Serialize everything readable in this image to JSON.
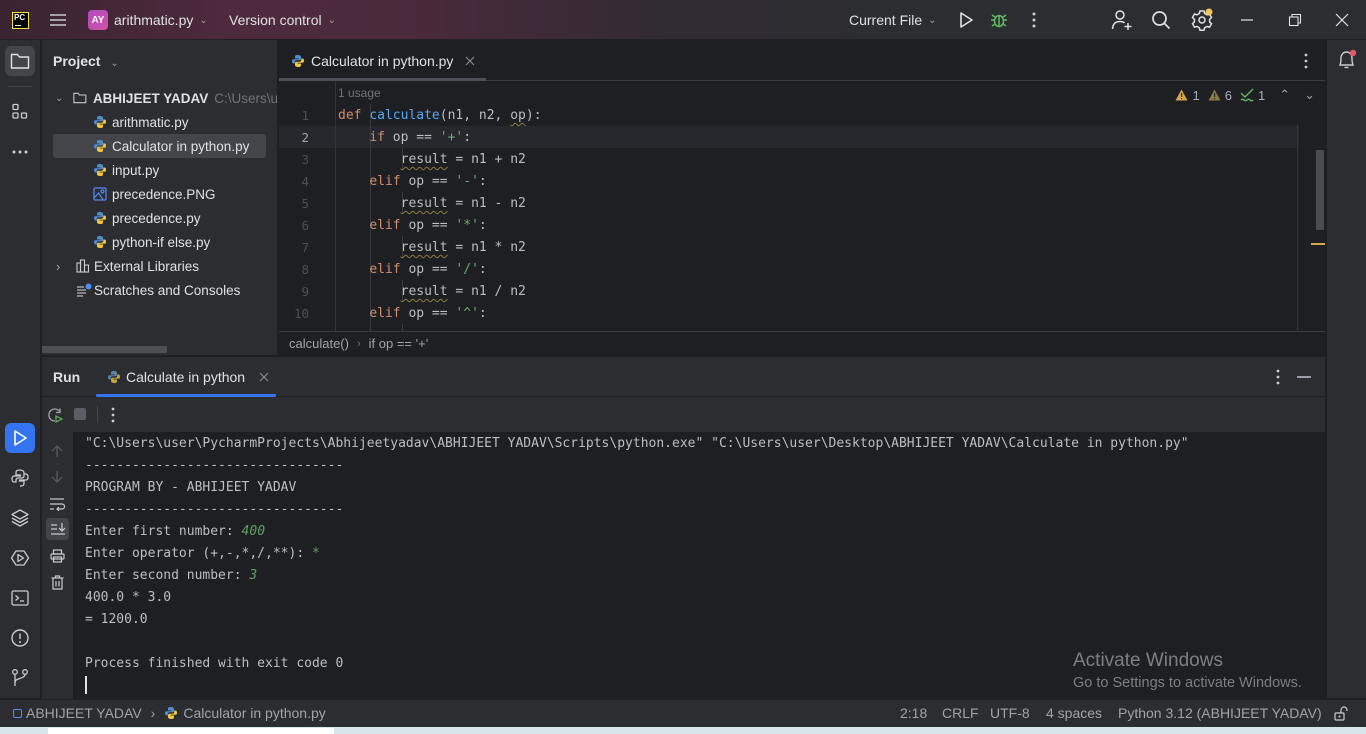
{
  "titlebar": {
    "logo": "PC",
    "project_badge": "AY",
    "project_name": "arithmatic.py",
    "vcs_label": "Version control",
    "run_config": "Current File",
    "icons": [
      "menu-icon",
      "run-icon",
      "debug-icon",
      "more-icon",
      "add-user-icon",
      "search-icon",
      "settings-icon",
      "minimize-icon",
      "restore-icon",
      "close-icon"
    ]
  },
  "project_panel": {
    "title": "Project",
    "root": {
      "name": "ABHIJEET YADAV",
      "path": "C:\\Users\\u"
    },
    "files": [
      {
        "name": "arithmatic.py",
        "icon": "python-file-icon"
      },
      {
        "name": "Calculator in python.py",
        "icon": "python-file-icon",
        "selected": true
      },
      {
        "name": "input.py",
        "icon": "python-file-icon"
      },
      {
        "name": "precedence.PNG",
        "icon": "image-file-icon"
      },
      {
        "name": "precedence.py",
        "icon": "python-file-icon"
      },
      {
        "name": "python-if else.py",
        "icon": "python-file-icon"
      }
    ],
    "external_libraries": "External Libraries",
    "scratches": "Scratches and Consoles"
  },
  "editor": {
    "tab_label": "Calculator in python.py",
    "usage_hint": "1 usage",
    "inspections": {
      "errors": "1",
      "warnings": "6",
      "typos": "1"
    },
    "line_numbers": [
      "1",
      "2",
      "3",
      "4",
      "5",
      "6",
      "7",
      "8",
      "9",
      "10"
    ],
    "current_line": "2",
    "code": [
      {
        "kw": "def",
        "fn": "calculate",
        "rest_a": "(n1, n2, ",
        "wavy": "op",
        "rest_b": "):"
      },
      {
        "indent": "    ",
        "kw": "if",
        "rest": " op == ",
        "str": "'+'",
        "end": ":"
      },
      {
        "indent": "        ",
        "wavy": "result",
        "rest": " = n1 + n2"
      },
      {
        "indent": "    ",
        "kw": "elif",
        "rest": " op == ",
        "str": "'-'",
        "end": ":"
      },
      {
        "indent": "        ",
        "wavy": "result",
        "rest": " = n1 - n2"
      },
      {
        "indent": "    ",
        "kw": "elif",
        "rest": " op == ",
        "str": "'*'",
        "end": ":"
      },
      {
        "indent": "        ",
        "wavy": "result",
        "rest": " = n1 * n2"
      },
      {
        "indent": "    ",
        "kw": "elif",
        "rest": " op == ",
        "str": "'/'",
        "end": ":"
      },
      {
        "indent": "        ",
        "wavy": "result",
        "rest": " = n1 / n2"
      },
      {
        "indent": "    ",
        "kw": "elif",
        "rest": " op == ",
        "str": "'^'",
        "end": ":"
      }
    ],
    "breadcrumb": [
      "calculate()",
      "if op == '+'"
    ]
  },
  "run_panel": {
    "title": "Run",
    "tab_label": "Calculate in python",
    "console": {
      "command": "\"C:\\Users\\user\\PycharmProjects\\Abhijeetyadav\\ABHIJEET YADAV\\Scripts\\python.exe\" \"C:\\Users\\user\\Desktop\\ABHIJEET YADAV\\Calculate in python.py\"",
      "separator": "---------------------------------",
      "banner": "PROGRAM BY - ABHIJEET YADAV",
      "prompt1": "Enter first number: ",
      "input1": "400",
      "prompt2": "Enter operator (+,-,*,/,**): ",
      "input2": "*",
      "prompt3": "Enter second number: ",
      "input3": "3",
      "expr": "400.0 * 3.0",
      "result": "= 1200.0",
      "exit": "Process finished with exit code 0"
    }
  },
  "watermark": {
    "line1": "Activate Windows",
    "line2": "Go to Settings to activate Windows."
  },
  "statusbar": {
    "project": "ABHIJEET YADAV",
    "file": "Calculator in python.py",
    "position": "2:18",
    "line_sep": "CRLF",
    "encoding": "UTF-8",
    "indent": "4 spaces",
    "interpreter": "Python 3.12 (ABHIJEET YADAV)"
  },
  "colors": {
    "accent": "#3574f0",
    "keyword": "#cf8e6d",
    "function": "#56a8f5",
    "string": "#6aab73",
    "user_input": "#5fa15f",
    "warning": "#d4a74b"
  }
}
